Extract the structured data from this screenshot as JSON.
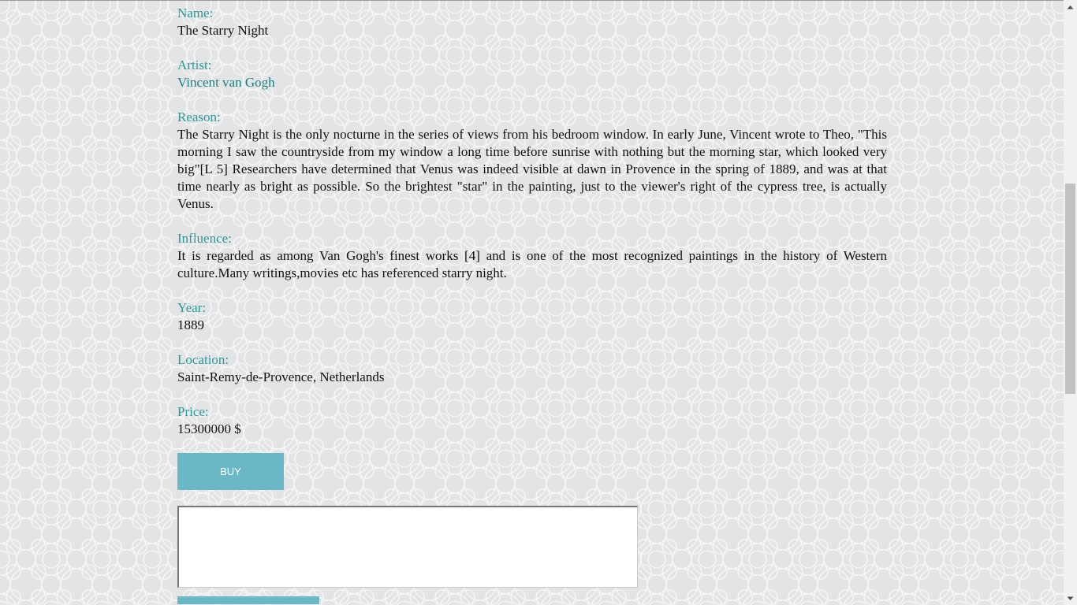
{
  "artwork": {
    "name_label": "Name:",
    "name": "The Starry Night",
    "artist_label": "Artist:",
    "artist": "Vincent van Gogh",
    "reason_label": "Reason:",
    "reason": "The Starry Night is the only nocturne in the series of views from his bedroom window. In early June, Vincent wrote to Theo, \"This morning I saw the countryside from my window a long time before sunrise with nothing but the morning star, which looked very big\"[L 5] Researchers have determined that Venus was indeed visible at dawn in Provence in the spring of 1889, and was at that time nearly as bright as possible. So the brightest \"star\" in the painting, just to the viewer's right of the cypress tree, is actually Venus.",
    "influence_label": "Influence:",
    "influence": "It is regarded as among Van Gogh's finest works [4] and is one of the most recognized paintings in the history of Western culture.Many writings,movies etc has referenced starry night.",
    "year_label": "Year:",
    "year": "1889",
    "location_label": "Location:",
    "location": "Saint-Remy-de-Provence, Netherlands",
    "price_label": "Price:",
    "price": "15300000 $"
  },
  "actions": {
    "buy_label": "BUY"
  },
  "comment": {
    "value": ""
  },
  "colors": {
    "label": "#2a9a98",
    "button": "#6ab8c6",
    "background": "#e3e4e6"
  },
  "icons": {
    "scroll_up": "triangle-up-icon",
    "scroll_down": "triangle-down-icon"
  }
}
